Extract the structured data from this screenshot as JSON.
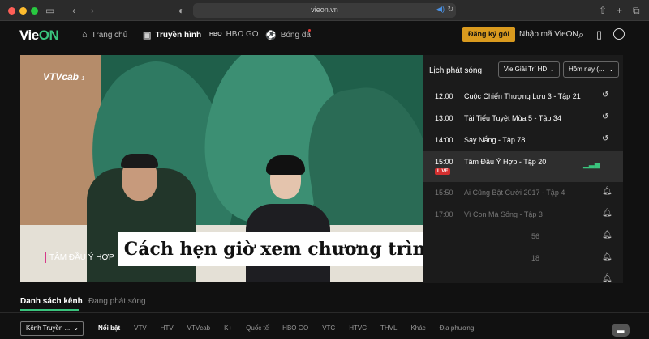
{
  "browser": {
    "url": "vieon.vn",
    "icons": [
      "sidebar-icon",
      "back-icon",
      "forward-icon",
      "shield-icon",
      "speaker-icon",
      "reload-icon",
      "share-icon",
      "new-tab-icon",
      "tabs-icon"
    ]
  },
  "site": {
    "logo_prefix": "Vie",
    "logo_suffix": "ON",
    "nav": [
      {
        "label": "Trang chủ",
        "icon": "home-icon"
      },
      {
        "label": "Truyền hình",
        "icon": "tv-icon",
        "active": true
      },
      {
        "label": "HBO GO",
        "icon": "hbo-icon"
      },
      {
        "label": "Bóng đá",
        "icon": "football-icon"
      }
    ],
    "register_label": "Đăng ký gói",
    "enter_code_label": "Nhập mã VieON"
  },
  "video": {
    "channel_logo": "VTVcab",
    "channel_logo_suffix": "1",
    "program_name": "TÂM ĐẦU Ý HỢP",
    "overlay_caption": "Cách hẹn giờ xem chương trình trên tivi"
  },
  "schedule": {
    "title": "Lịch phát sóng",
    "channel_select": "Vie Giải Trí HD",
    "day_select": "Hôm nay (...",
    "live_badge": "LIVE",
    "items": [
      {
        "time": "12:00",
        "name": "Cuộc Chiến Thượng Lưu 3 - Tập 21",
        "state": "past"
      },
      {
        "time": "13:00",
        "name": "Tài Tiếu Tuyệt Mùa 5 - Tập 34",
        "state": "past"
      },
      {
        "time": "14:00",
        "name": "Say Nắng - Tập 78",
        "state": "past"
      },
      {
        "time": "15:00",
        "name": "Tâm Đầu Ý Hợp - Tập 20",
        "state": "live"
      },
      {
        "time": "15:50",
        "name": "Ai Cũng Bật Cười 2017 - Tập 4",
        "state": "future"
      },
      {
        "time": "17:00",
        "name": "Vì Con Mà Sống - Tập 3",
        "state": "future"
      },
      {
        "time": "",
        "name": "56",
        "state": "future"
      },
      {
        "time": "",
        "name": "18",
        "state": "future"
      },
      {
        "time": "",
        "name": "",
        "state": "future"
      }
    ]
  },
  "tabs": {
    "channels": "Danh sách kênh",
    "broadcasting": "Đang phát sóng"
  },
  "filter": {
    "selected": "Kênh Truyền ..."
  },
  "categories": [
    "Nổi bật",
    "VTV",
    "HTV",
    "VTVcab",
    "K+",
    "Quốc tế",
    "HBO GO",
    "VTC",
    "HTVC",
    "THVL",
    "Khác",
    "Địa phương"
  ],
  "colors": {
    "accent": "#3ac47d",
    "register": "#d99a1e",
    "live": "#d32f2f"
  }
}
